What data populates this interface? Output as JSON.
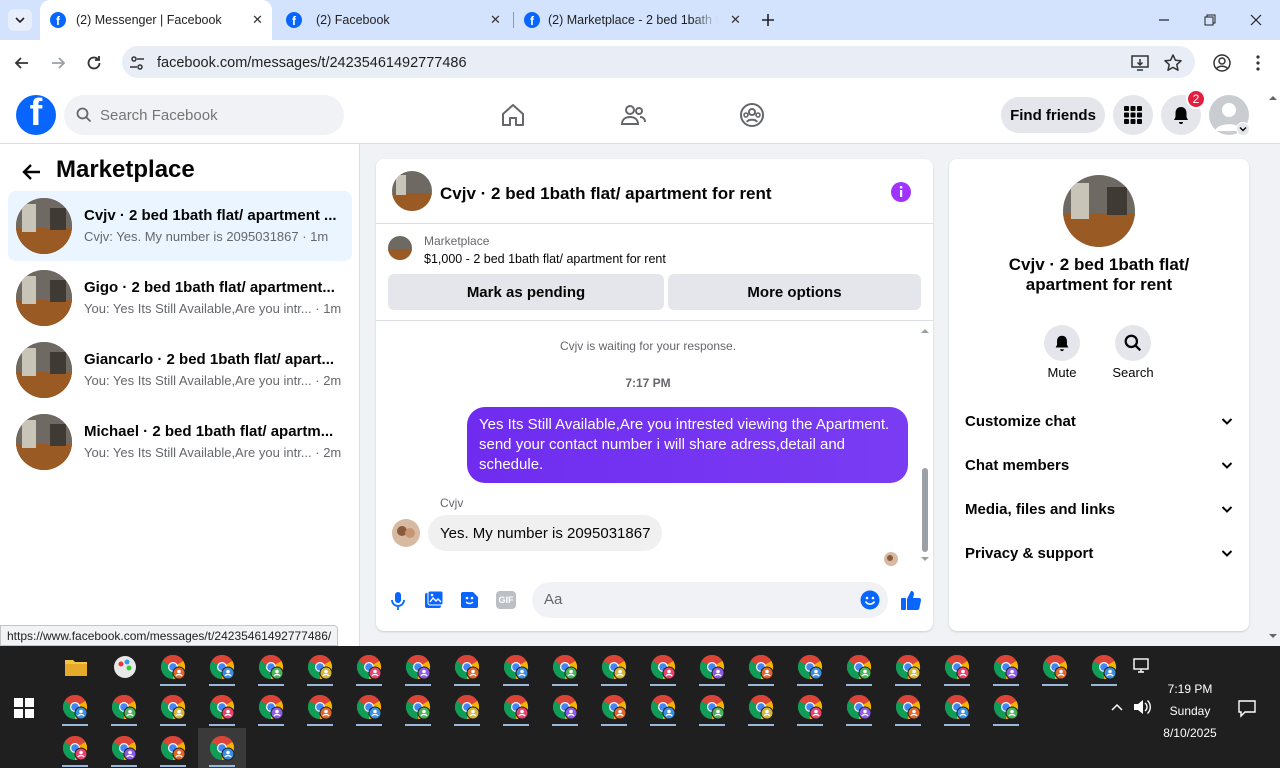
{
  "browser": {
    "tabs": [
      {
        "title": "(2) Messenger | Facebook",
        "active": true
      },
      {
        "title": "(2) Facebook",
        "active": false
      },
      {
        "title": "(2) Marketplace - 2 bed 1bath fl",
        "active": false
      }
    ],
    "url": "facebook.com/messages/t/24235461492777486",
    "status_url": "https://www.facebook.com/messages/t/24235461492777486/"
  },
  "fb_header": {
    "logo": "f",
    "search_placeholder": "Search Facebook",
    "find_friends": "Find friends",
    "notification_count": "2"
  },
  "left_panel": {
    "title": "Marketplace",
    "conversations": [
      {
        "name": "Cvjv · 2 bed 1bath flat/ apartment ...",
        "preview": "Cvjv: Yes. My number is 2095031867 · 1m"
      },
      {
        "name": "Gigo · 2 bed 1bath flat/ apartment...",
        "preview": "You: Yes Its Still Available,Are you intr... · 1m"
      },
      {
        "name": "Giancarlo · 2 bed 1bath flat/ apart...",
        "preview": "You: Yes Its Still Available,Are you intr... · 2m"
      },
      {
        "name": "Michael · 2 bed 1bath flat/ apartm...",
        "preview": "You: Yes Its Still Available,Are you intr... · 2m"
      }
    ]
  },
  "chat": {
    "title": "Cvjv · 2 bed 1bath flat/ apartment for rent",
    "listing_source": "Marketplace",
    "listing_detail": "$1,000 - 2 bed 1bath flat/ apartment for rent",
    "mark_pending": "Mark as pending",
    "more_options": "More options",
    "waiting_notice": "Cvjv is waiting for your response.",
    "timestamp": "7:17 PM",
    "outgoing_message": "Yes Its Still Available,Are you intrested viewing the Apartment. send your contact number i will share adress,detail and schedule.",
    "incoming_sender": "Cvjv",
    "incoming_message": "Yes. My number is 2095031867",
    "composer_placeholder": "Aa",
    "gif_label": "GIF"
  },
  "info_panel": {
    "title": "Cvjv · 2 bed 1bath flat/ apartment for rent",
    "mute": "Mute",
    "search": "Search",
    "sections": [
      "Customize chat",
      "Chat members",
      "Media, files and links",
      "Privacy & support"
    ]
  },
  "taskbar": {
    "time": "7:19 PM",
    "day": "Sunday",
    "date": "8/10/2025"
  },
  "colors": {
    "fb_blue": "#0866ff",
    "bubble_gradient_start": "#6f2cf0",
    "bubble_gradient_end": "#7a3cf3",
    "info_icon": "#a033ff",
    "badge_red": "#e41e3f"
  }
}
